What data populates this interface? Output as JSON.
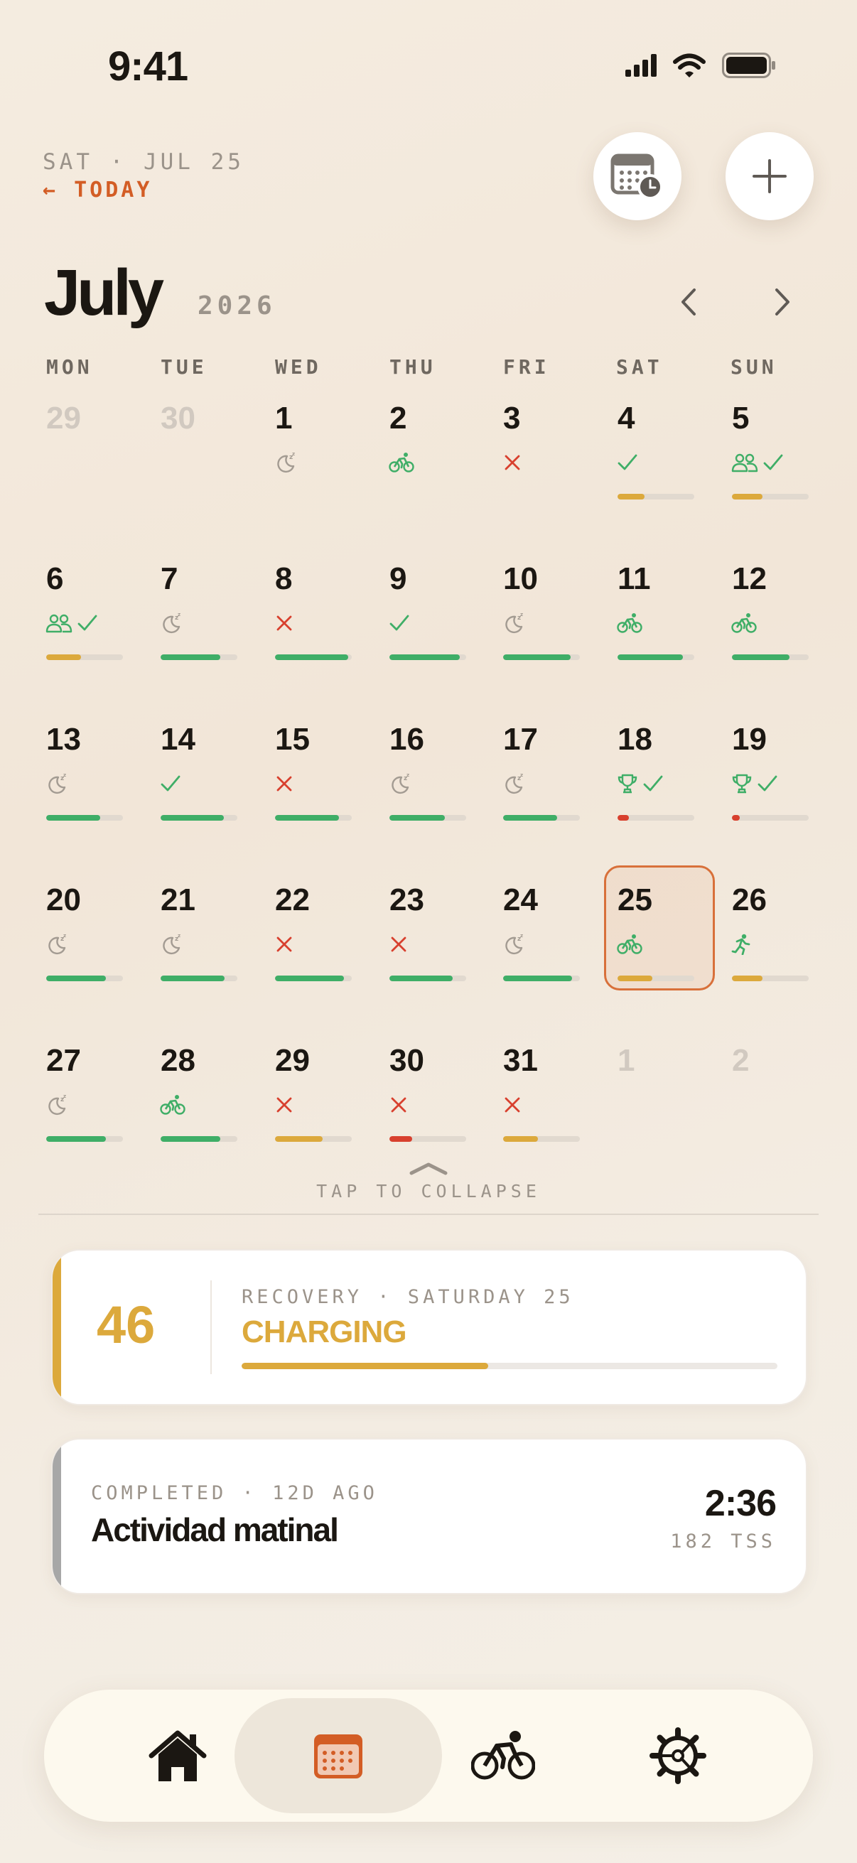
{
  "status_bar": {
    "time": "9:41",
    "icons": [
      "cellular-signal-icon",
      "wifi-icon",
      "battery-icon"
    ]
  },
  "header": {
    "date_line": "SAT · JUL 25",
    "today_link": "← TODAY",
    "buttons": [
      "calendar-history-icon",
      "plus-icon"
    ],
    "month": "July",
    "year": "2026"
  },
  "calendar": {
    "weekdays": [
      "MON",
      "TUE",
      "WED",
      "THU",
      "FRI",
      "SAT",
      "SUN"
    ],
    "days": [
      {
        "day": "29",
        "muted": true,
        "icons": []
      },
      {
        "day": "30",
        "muted": true,
        "icons": []
      },
      {
        "day": "1",
        "icons": [
          "sleep"
        ]
      },
      {
        "day": "2",
        "icons": [
          "bike"
        ]
      },
      {
        "day": "3",
        "icons": [
          "cross"
        ]
      },
      {
        "day": "4",
        "icons": [
          "check"
        ],
        "bar": 0.35,
        "bar_status": "yellow"
      },
      {
        "day": "5",
        "icons": [
          "group",
          "check"
        ],
        "bar": 0.4,
        "bar_status": "yellow"
      },
      {
        "day": "6",
        "icons": [
          "group",
          "check"
        ],
        "bar": 0.45,
        "bar_status": "yellow"
      },
      {
        "day": "7",
        "icons": [
          "sleep"
        ],
        "bar": 0.78,
        "bar_status": "green"
      },
      {
        "day": "8",
        "icons": [
          "cross"
        ],
        "bar": 0.95,
        "bar_status": "green"
      },
      {
        "day": "9",
        "icons": [
          "check"
        ],
        "bar": 0.92,
        "bar_status": "green"
      },
      {
        "day": "10",
        "icons": [
          "sleep"
        ],
        "bar": 0.88,
        "bar_status": "green"
      },
      {
        "day": "11",
        "icons": [
          "bike"
        ],
        "bar": 0.85,
        "bar_status": "green"
      },
      {
        "day": "12",
        "icons": [
          "bike"
        ],
        "bar": 0.75,
        "bar_status": "green"
      },
      {
        "day": "13",
        "icons": [
          "sleep"
        ],
        "bar": 0.7,
        "bar_status": "green"
      },
      {
        "day": "14",
        "icons": [
          "check"
        ],
        "bar": 0.82,
        "bar_status": "green"
      },
      {
        "day": "15",
        "icons": [
          "cross"
        ],
        "bar": 0.83,
        "bar_status": "green"
      },
      {
        "day": "16",
        "icons": [
          "sleep"
        ],
        "bar": 0.72,
        "bar_status": "green"
      },
      {
        "day": "17",
        "icons": [
          "sleep"
        ],
        "bar": 0.7,
        "bar_status": "green"
      },
      {
        "day": "18",
        "icons": [
          "trophy",
          "check"
        ],
        "bar": 0.15,
        "bar_status": "red"
      },
      {
        "day": "19",
        "icons": [
          "trophy",
          "check"
        ],
        "bar": 0.1,
        "bar_status": "red"
      },
      {
        "day": "20",
        "icons": [
          "sleep"
        ],
        "bar": 0.78,
        "bar_status": "green"
      },
      {
        "day": "21",
        "icons": [
          "sleep"
        ],
        "bar": 0.83,
        "bar_status": "green"
      },
      {
        "day": "22",
        "icons": [
          "cross"
        ],
        "bar": 0.9,
        "bar_status": "green"
      },
      {
        "day": "23",
        "icons": [
          "cross"
        ],
        "bar": 0.82,
        "bar_status": "green"
      },
      {
        "day": "24",
        "icons": [
          "sleep"
        ],
        "bar": 0.9,
        "bar_status": "green"
      },
      {
        "day": "25",
        "icons": [
          "bike"
        ],
        "bar": 0.45,
        "bar_status": "yellow",
        "selected": true
      },
      {
        "day": "26",
        "icons": [
          "run"
        ],
        "bar": 0.4,
        "bar_status": "yellow"
      },
      {
        "day": "27",
        "icons": [
          "sleep"
        ],
        "bar": 0.78,
        "bar_status": "green"
      },
      {
        "day": "28",
        "icons": [
          "bike"
        ],
        "bar": 0.78,
        "bar_status": "green"
      },
      {
        "day": "29",
        "icons": [
          "cross"
        ],
        "bar": 0.62,
        "bar_status": "yellow"
      },
      {
        "day": "30",
        "icons": [
          "cross"
        ],
        "bar": 0.3,
        "bar_status": "red"
      },
      {
        "day": "31",
        "icons": [
          "cross"
        ],
        "bar": 0.45,
        "bar_status": "yellow"
      },
      {
        "day": "1",
        "muted": true,
        "icons": []
      },
      {
        "day": "2",
        "muted": true,
        "icons": []
      }
    ],
    "collapse_label": "TAP TO COLLAPSE"
  },
  "recovery_card": {
    "score": "46",
    "label": "RECOVERY · SATURDAY 25",
    "status": "CHARGING",
    "progress": 0.46,
    "color": "#dca93c"
  },
  "activity_card": {
    "label": "COMPLETED · 12D AGO",
    "title": "Actividad matinal",
    "time": "2:36",
    "tss": "182 TSS",
    "color": "#a7a7a7"
  },
  "colors": {
    "accent": "#d35d25",
    "green": "#3fae67",
    "yellow": "#dca93c",
    "red": "#d8402e"
  },
  "tabbar": {
    "tabs": [
      {
        "icon": "home-icon",
        "active": false
      },
      {
        "icon": "calendar-icon",
        "active": true
      },
      {
        "icon": "cyclist-icon",
        "active": false
      },
      {
        "icon": "settings-gear-icon",
        "active": false
      }
    ]
  }
}
